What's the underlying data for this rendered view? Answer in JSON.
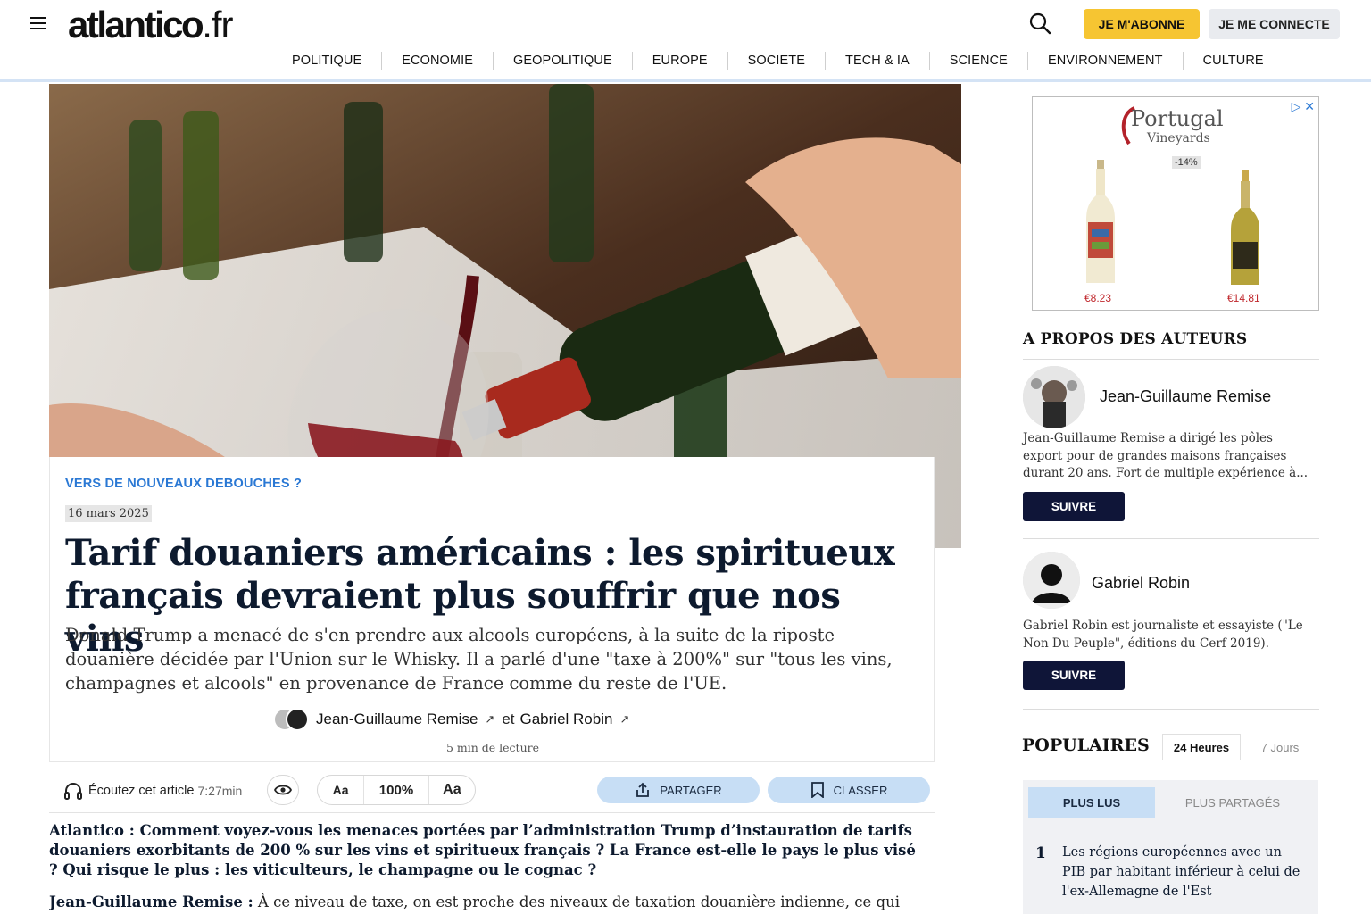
{
  "header": {
    "logo_main": "atlantico",
    "logo_tld": ".fr",
    "menu_icon": "hamburger-menu-icon",
    "search_icon": "search-icon",
    "subscribe_label": "JE M'ABONNE",
    "login_label": "JE ME CONNECTE",
    "subscribe_color": "#f6c532"
  },
  "nav": {
    "items": [
      "POLITIQUE",
      "ECONOMIE",
      "GEOPOLITIQUE",
      "EUROPE",
      "SOCIETE",
      "TECH & IA",
      "SCIENCE",
      "ENVIRONNEMENT",
      "CULTURE"
    ]
  },
  "article": {
    "kicker": "VERS DE NOUVEAUX DEBOUCHES ?",
    "date": "16 mars 2025",
    "title": "Tarif douaniers américains : les spiritueux français devraient plus souffrir que nos vins",
    "chapo": "Donald Trump a menacé de s'en prendre aux alcools européens, à la suite de la riposte douanière décidée par l'Union sur le Whisky. Il a parlé d'une \"taxe à 200%\" sur \"tous les vins, champagnes et alcools\" en provenance de France comme du reste de l'UE.",
    "author1": "Jean-Guillaume Remise",
    "author_sep": "et",
    "author2": "Gabriel Robin",
    "read_time": "5 min de lecture",
    "accent_color": "#2a78d4"
  },
  "toolbar": {
    "listen_label": "Écoutez cet article",
    "listen_duration": "7:27min",
    "font_smaller": "Aa",
    "zoom": "100%",
    "font_larger": "Aa",
    "share_label": "PARTAGER",
    "save_label": "CLASSER"
  },
  "body": {
    "question": "Atlantico : Comment voyez-vous les menaces portées par l’administration Trump d’instauration de tarifs douaniers exorbitants de 200 % sur les vins et spiritueux français ? La France est-elle le pays le plus visé ? Qui risque le plus : les viticulteurs, le champagne ou le cognac ?",
    "answer_speaker": "Jean-Guillaume Remise :",
    "answer_text": " À ce niveau de taxe, on est proche des niveaux de taxation douanière indienne, ce qui"
  },
  "ad": {
    "brand": "Portugal",
    "brand_sub": "Vineyards",
    "discount": "-14%",
    "price1": "€8.23",
    "price2": "€14.81",
    "ad_controls": "▷ ✕"
  },
  "authors": {
    "section_title": "A PROPOS DES AUTEURS",
    "list": [
      {
        "name": "Jean-Guillaume Remise",
        "bio": "Jean-Guillaume Remise a dirigé les pôles export pour de grandes maisons françaises durant 20 ans. Fort de multiple expérience à...",
        "follow_label": "SUIVRE"
      },
      {
        "name": "Gabriel Robin",
        "bio": "Gabriel Robin est journaliste et essayiste (\"Le Non Du Peuple\", éditions du Cerf 2019).",
        "follow_label": "SUIVRE"
      }
    ]
  },
  "popular": {
    "title": "POPULAIRES",
    "tab_24h": "24 Heures",
    "tab_7d": "7 Jours",
    "sub_most_read": "PLUS LUS",
    "sub_most_shared": "PLUS PARTAGÉS",
    "items": [
      {
        "rank": "1",
        "title": "Les régions européennes avec un PIB par habitant inférieur à celui de l'ex-Allemagne de l'Est"
      }
    ]
  }
}
